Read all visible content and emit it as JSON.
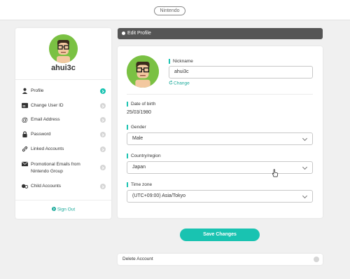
{
  "header": {
    "logo_text": "Nintendo"
  },
  "sidebar": {
    "username": "ahui3c",
    "items": [
      {
        "label": "Profile",
        "icon": "person-icon",
        "active": true
      },
      {
        "label": "Change User ID",
        "icon": "id-card-icon",
        "active": false
      },
      {
        "label": "Email Address",
        "icon": "at-sign-icon",
        "active": false
      },
      {
        "label": "Password",
        "icon": "lock-icon",
        "active": false
      },
      {
        "label": "Linked Accounts",
        "icon": "link-icon",
        "active": false
      },
      {
        "label": "Promotional Emails from Nintendo Group",
        "icon": "envelope-icon",
        "active": false
      },
      {
        "label": "Child Accounts",
        "icon": "child-accounts-icon",
        "active": false
      }
    ],
    "sign_out": "Sign Out"
  },
  "edit_profile": {
    "header": "Edit Profile",
    "nickname_label": "Nickname",
    "nickname_value": "ahui3c",
    "change_link": "Change",
    "dob_label": "Date of birth",
    "dob_value": "25/03/1980",
    "gender_label": "Gender",
    "gender_value": "Male",
    "country_label": "Country/region",
    "country_value": "Japan",
    "timezone_label": "Time zone",
    "timezone_value": "(UTC+09:00) Asia/Tokyo",
    "save_button": "Save Changes"
  },
  "delete_account": {
    "label": "Delete Account"
  },
  "colors": {
    "accent": "#19c3b1",
    "header_bar": "#555555",
    "avatar_bg": "#7ac143"
  }
}
